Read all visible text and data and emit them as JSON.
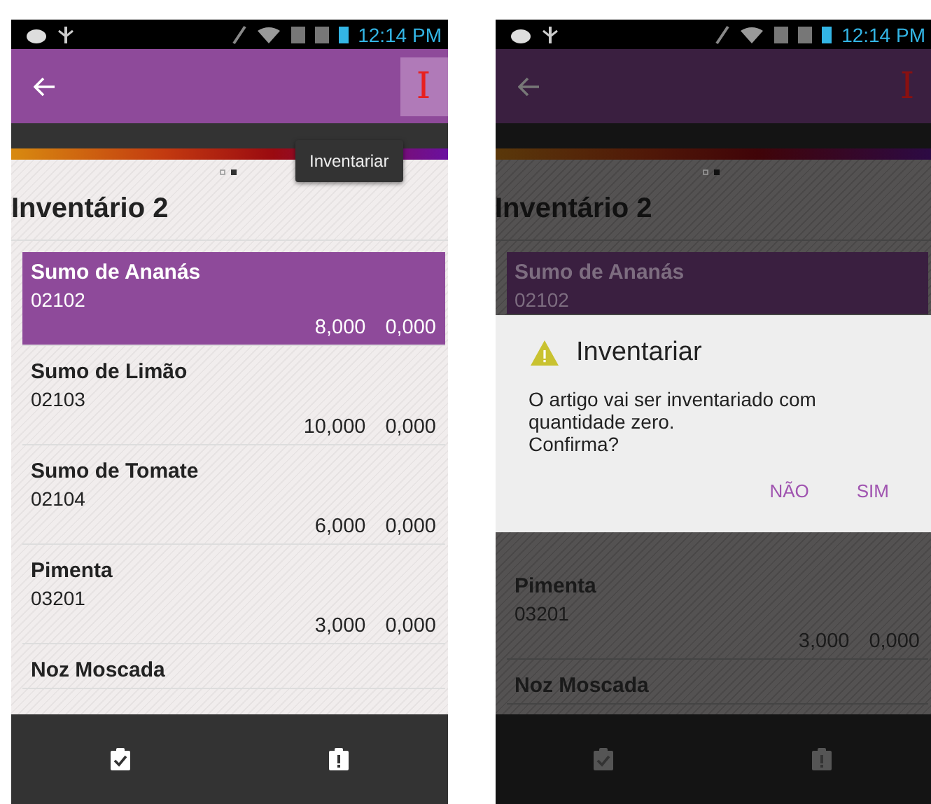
{
  "screens": [
    {
      "dimmed": false,
      "status_bar": {
        "time": "12:14 PM"
      },
      "app_bar": {
        "action": "I"
      },
      "tooltip": "Inventariar",
      "title": "Inventário 2",
      "rows": [
        {
          "name": "Sumo de Ananás",
          "code": "02102",
          "qty": "8,000",
          "counted": "0,000",
          "selected": true
        },
        {
          "name": "Sumo de Limão",
          "code": "02103",
          "qty": "10,000",
          "counted": "0,000",
          "selected": false
        },
        {
          "name": "Sumo de Tomate",
          "code": "02104",
          "qty": "6,000",
          "counted": "0,000",
          "selected": false
        },
        {
          "name": "Pimenta",
          "code": "03201",
          "qty": "3,000",
          "counted": "0,000",
          "selected": false
        },
        {
          "name": "Noz Moscada",
          "selected": false
        }
      ]
    },
    {
      "dimmed": true,
      "status_bar": {
        "time": "12:14 PM"
      },
      "app_bar": {
        "action": "I"
      },
      "title": "Inventário 2",
      "rows": [
        {
          "name": "Sumo de Ananás",
          "code": "02102",
          "selected": true
        }
      ],
      "dialog": {
        "title": "Inventariar",
        "message": "O artigo vai ser inventariado com quantidade zero.\nConfirma?",
        "buttons": [
          "NÃO",
          "SIM"
        ]
      },
      "rows_below": [
        {
          "name": "Pimenta",
          "code": "03201",
          "qty": "3,000",
          "counted": "0,000",
          "selected": false
        },
        {
          "name": "Noz Moscada",
          "selected": false
        }
      ]
    }
  ]
}
